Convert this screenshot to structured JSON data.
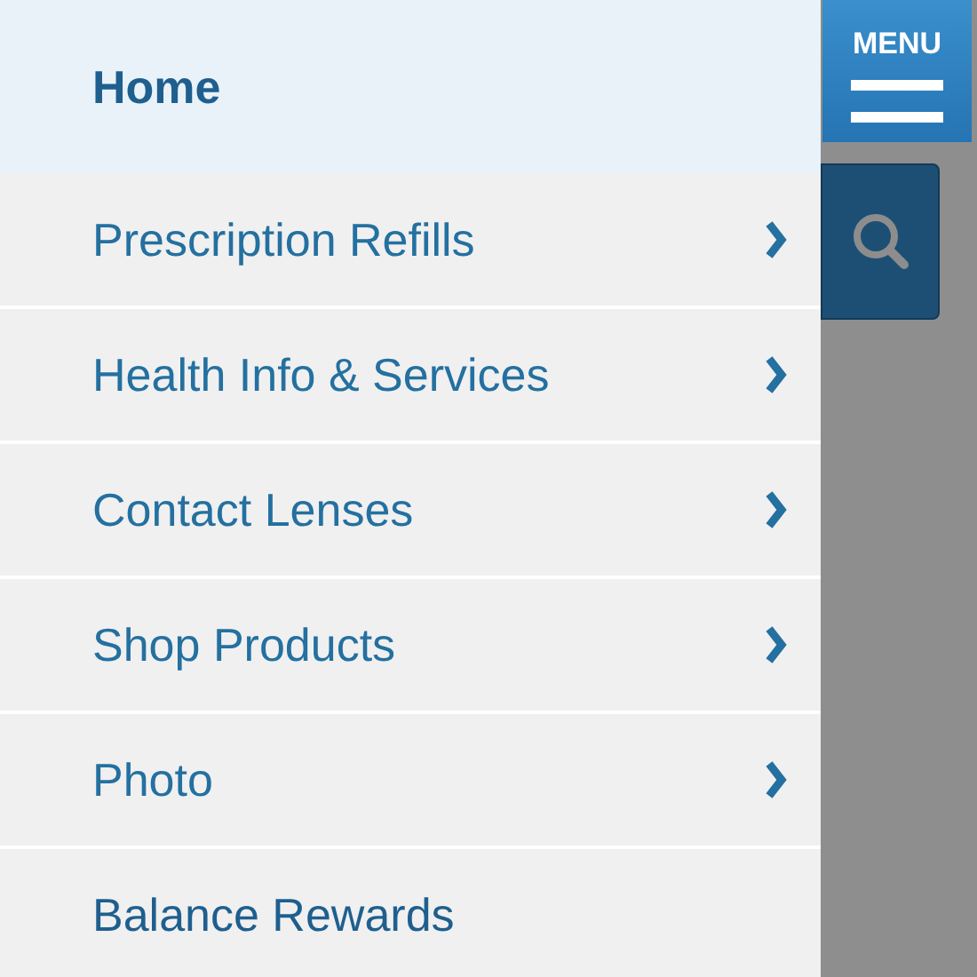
{
  "menu_items": [
    {
      "label": "Home",
      "selected": true,
      "has_submenu": false
    },
    {
      "label": "Prescription Refills",
      "selected": false,
      "has_submenu": true
    },
    {
      "label": "Health Info & Services",
      "selected": false,
      "has_submenu": true
    },
    {
      "label": "Contact Lenses",
      "selected": false,
      "has_submenu": true
    },
    {
      "label": "Shop Products",
      "selected": false,
      "has_submenu": true
    },
    {
      "label": "Photo",
      "selected": false,
      "has_submenu": true
    },
    {
      "label": "Balance Rewards",
      "selected": false,
      "has_submenu": false
    }
  ],
  "menu_button": {
    "label": "MENU"
  }
}
